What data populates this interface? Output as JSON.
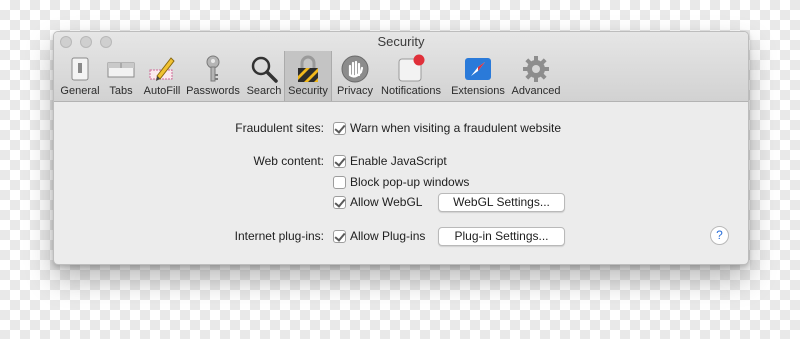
{
  "window": {
    "title": "Security"
  },
  "toolbar": {
    "tabs": [
      {
        "label": "General",
        "icon": "general-icon"
      },
      {
        "label": "Tabs",
        "icon": "tabs-icon"
      },
      {
        "label": "AutoFill",
        "icon": "autofill-icon"
      },
      {
        "label": "Passwords",
        "icon": "key-icon"
      },
      {
        "label": "Search",
        "icon": "magnifier-icon"
      },
      {
        "label": "Security",
        "icon": "lock-icon",
        "selected": true
      },
      {
        "label": "Privacy",
        "icon": "hand-icon"
      },
      {
        "label": "Notifications",
        "icon": "notifications-icon"
      },
      {
        "label": "Extensions",
        "icon": "compass-icon"
      },
      {
        "label": "Advanced",
        "icon": "gear-icon"
      }
    ]
  },
  "content": {
    "fraudulent": {
      "label": "Fraudulent sites:",
      "option": "Warn when visiting a fraudulent website",
      "checked": true
    },
    "web_content": {
      "label": "Web content:",
      "options": [
        {
          "text": "Enable JavaScript",
          "checked": true
        },
        {
          "text": "Block pop-up windows",
          "checked": false
        },
        {
          "text": "Allow WebGL",
          "checked": true
        }
      ],
      "webgl_button": "WebGL Settings..."
    },
    "plugins": {
      "label": "Internet plug-ins:",
      "option": "Allow Plug-ins",
      "checked": true,
      "button": "Plug-in Settings..."
    },
    "help": "?"
  },
  "colors": {
    "accent_blue": "#2a6fd9",
    "notification_red": "#e0303a",
    "window_bg": "#ececec"
  }
}
